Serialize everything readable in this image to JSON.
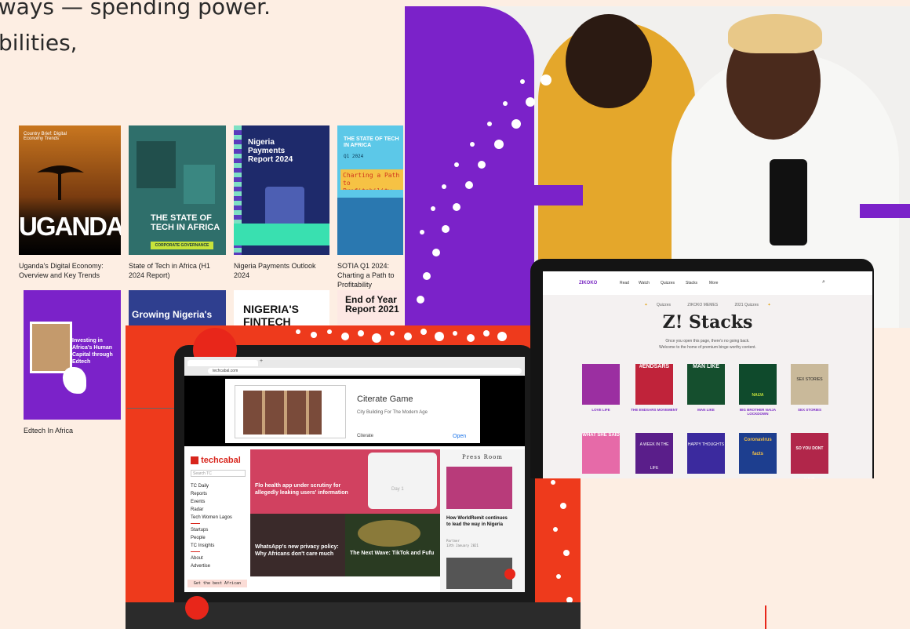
{
  "hero": {
    "line1": "lways — spending power.",
    "line2": "bilities,"
  },
  "reports": [
    {
      "caption": "Uganda's Digital Economy: Overview and Key Trends",
      "cover_title": "UGANDA",
      "cover_sub": "Country Brief: Digital Economy Trends"
    },
    {
      "caption": "State of Tech in Africa (H1 2024 Report)",
      "cover_title": "THE STATE OF TECH IN AFRICA",
      "cover_tag": "CORPORATE GOVERNANCE"
    },
    {
      "caption": "Nigeria Payments Outlook 2024",
      "cover_title": "Nigeria Payments Report 2024"
    },
    {
      "caption": "SOTIA Q1 2024: Charting a Path to Profitability",
      "cover_title": "THE STATE OF TECH IN AFRICA",
      "cover_q": "Q1 2024",
      "cover_banner": "Charting a Path to Profitability"
    },
    {
      "caption": "Edtech In Africa",
      "cover_title": "Investing in Africa's Human Capital through Edtech"
    },
    {
      "caption": "",
      "cover_title": "Growing Nigeria's"
    },
    {
      "caption": "",
      "cover_title": "NIGERIA'S FINTECH"
    },
    {
      "caption": "",
      "cover_title": "End of Year Report 2021"
    }
  ],
  "techcabal": {
    "url": "techcabal.com",
    "ad_title": "Citerate Game",
    "ad_sub": "City Building For The Modern Age",
    "ad_brand": "Citerate",
    "ad_open": "Open",
    "logo": "techcabal",
    "search_placeholder": "Search TC",
    "nav": [
      "TC Daily",
      "Reports",
      "Events",
      "Radar",
      "Tech Women Lagos",
      "Startups",
      "People",
      "TC Insights",
      "About",
      "Advertise"
    ],
    "cta": "Get the best African",
    "headline1": "Flo health app under scrutiny for allegedly leaking users' information",
    "headline2": "WhatsApp's new privacy policy: Why Africans don't care much",
    "headline3": "The Next Wave: TikTok and Fufu",
    "press_room": "Press Room",
    "press_headline": "How WorldRemit continues to lead the way in Nigeria",
    "press_meta": "Partner",
    "press_date": "13th January 2021",
    "day_card": "Day 1"
  },
  "zikoko": {
    "logo": "ZIKOKO",
    "nav": [
      "Read",
      "Watch",
      "Quizzes",
      "Stacks",
      "More"
    ],
    "subnav": [
      "Quizzes",
      "ZIKOKO MEMES",
      "2021 Quizzes"
    ],
    "title": "Z! Stacks",
    "subtitle": "Once you open this page, there's no going back.",
    "subtitle2": "Welcome to the home of premium binge worthy content.",
    "stacks": [
      "LOVE LIFE",
      "THE ENDSARS MOVEMENT",
      "MAN LIKE",
      "BIG BROTHER NAIJA LOCKDOWN",
      "SEX STORIES"
    ],
    "stack_tiles": [
      "",
      "#ENDSARS",
      "MAN LIKE",
      "NAIJA",
      "SEX STORIES"
    ],
    "row2_tiles": [
      "WHAT SHE SAID",
      "A WEEK IN THE LIFE",
      "HAPPY THOUGHTS",
      "Coronavirus facts",
      "SO YOU DONT HAVE"
    ]
  },
  "colors": {
    "accent_red": "#ee3a1c",
    "purple": "#7b22c9",
    "tc_red": "#d8251c",
    "zikoko_purple": "#7c2cc4"
  }
}
